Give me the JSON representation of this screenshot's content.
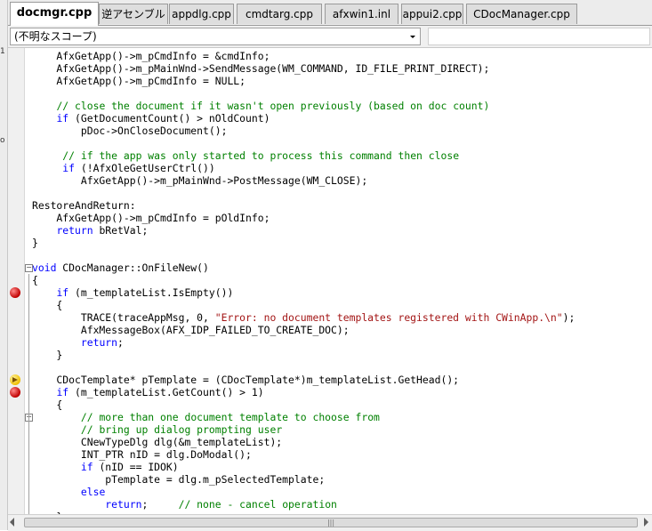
{
  "tabs": [
    {
      "label": "docmgr.cpp",
      "active": true
    },
    {
      "label": "逆アセンブル",
      "active": false
    },
    {
      "label": "appdlg.cpp",
      "active": false
    },
    {
      "label": "cmdtarg.cpp",
      "active": false
    },
    {
      "label": "afxwin1.inl",
      "active": false
    },
    {
      "label": "appui2.cpp",
      "active": false
    },
    {
      "label": "CDocManager.cpp",
      "active": false
    }
  ],
  "scope": {
    "value": "(不明なスコープ)",
    "dropdown_icon": "chevron-down-icon"
  },
  "left_strip": {
    "chars": [
      "1",
      "o"
    ]
  },
  "code_lines": [
    [
      {
        "t": "    AfxGetApp()->m_pCmdInfo = &cmdInfo;"
      }
    ],
    [
      {
        "t": "    AfxGetApp()->m_pMainWnd->SendMessage(WM_COMMAND, ID_FILE_PRINT_DIRECT);"
      }
    ],
    [
      {
        "t": "    AfxGetApp()->m_pCmdInfo = NULL;"
      }
    ],
    [
      {
        "t": ""
      }
    ],
    [
      {
        "t": "    "
      },
      {
        "t": "// close the document if it wasn't open previously (based on doc count)",
        "c": "cm"
      }
    ],
    [
      {
        "t": "    "
      },
      {
        "t": "if",
        "c": "kw"
      },
      {
        "t": " (GetDocumentCount() > nOldCount)"
      }
    ],
    [
      {
        "t": "        pDoc->OnCloseDocument();"
      }
    ],
    [
      {
        "t": ""
      }
    ],
    [
      {
        "t": "     "
      },
      {
        "t": "// if the app was only started to process this command then close",
        "c": "cm"
      }
    ],
    [
      {
        "t": "     "
      },
      {
        "t": "if",
        "c": "kw"
      },
      {
        "t": " (!AfxOleGetUserCtrl())"
      }
    ],
    [
      {
        "t": "        AfxGetApp()->m_pMainWnd->PostMessage(WM_CLOSE);"
      }
    ],
    [
      {
        "t": ""
      }
    ],
    [
      {
        "t": "RestoreAndReturn:"
      }
    ],
    [
      {
        "t": "    AfxGetApp()->m_pCmdInfo = pOldInfo;"
      }
    ],
    [
      {
        "t": "    "
      },
      {
        "t": "return",
        "c": "kw"
      },
      {
        "t": " bRetVal;"
      }
    ],
    [
      {
        "t": "}"
      }
    ],
    [
      {
        "t": ""
      }
    ],
    [
      {
        "t": "void",
        "c": "kw"
      },
      {
        "t": " CDocManager::OnFileNew()"
      }
    ],
    [
      {
        "t": "{"
      }
    ],
    [
      {
        "t": "    "
      },
      {
        "t": "if",
        "c": "kw"
      },
      {
        "t": " (m_templateList.IsEmpty())"
      }
    ],
    [
      {
        "t": "    {"
      }
    ],
    [
      {
        "t": "        TRACE(traceAppMsg, 0, "
      },
      {
        "t": "\"Error: no document templates registered with CWinApp.\\n\"",
        "c": "st"
      },
      {
        "t": ");"
      }
    ],
    [
      {
        "t": "        AfxMessageBox(AFX_IDP_FAILED_TO_CREATE_DOC);"
      }
    ],
    [
      {
        "t": "        "
      },
      {
        "t": "return",
        "c": "kw"
      },
      {
        "t": ";"
      }
    ],
    [
      {
        "t": "    }"
      }
    ],
    [
      {
        "t": ""
      }
    ],
    [
      {
        "t": "    CDocTemplate* pTemplate = (CDocTemplate*)m_templateList.GetHead();"
      }
    ],
    [
      {
        "t": "    "
      },
      {
        "t": "if",
        "c": "kw"
      },
      {
        "t": " (m_templateList.GetCount() > 1)"
      }
    ],
    [
      {
        "t": "    {"
      }
    ],
    [
      {
        "t": "        "
      },
      {
        "t": "// more than one document template to choose from",
        "c": "cm"
      }
    ],
    [
      {
        "t": "        "
      },
      {
        "t": "// bring up dialog prompting user",
        "c": "cm"
      }
    ],
    [
      {
        "t": "        CNewTypeDlg dlg(&m_templateList);"
      }
    ],
    [
      {
        "t": "        INT_PTR nID = dlg.DoModal();"
      }
    ],
    [
      {
        "t": "        "
      },
      {
        "t": "if",
        "c": "kw"
      },
      {
        "t": " (nID == IDOK)"
      }
    ],
    [
      {
        "t": "            pTemplate = dlg.m_pSelectedTemplate;"
      }
    ],
    [
      {
        "t": "        "
      },
      {
        "t": "else",
        "c": "kw"
      }
    ],
    [
      {
        "t": "            "
      },
      {
        "t": "return",
        "c": "kw"
      },
      {
        "t": ";     "
      },
      {
        "t": "// none - cancel operation",
        "c": "cm"
      }
    ],
    [
      {
        "t": "    }"
      }
    ]
  ],
  "markers": [
    {
      "line": 19,
      "type": "breakpoint",
      "icon": "breakpoint-icon"
    },
    {
      "line": 26,
      "type": "current-statement",
      "icon": "current-statement-arrow-icon"
    },
    {
      "line": 27,
      "type": "breakpoint",
      "icon": "breakpoint-icon"
    }
  ],
  "folds": [
    {
      "line": 17,
      "symbol": "⊟",
      "icon": "collapse-icon"
    },
    {
      "line": 29,
      "symbol": "⊟",
      "icon": "collapse-icon"
    }
  ],
  "scrollbar": {
    "thumb_grip": "|||"
  }
}
